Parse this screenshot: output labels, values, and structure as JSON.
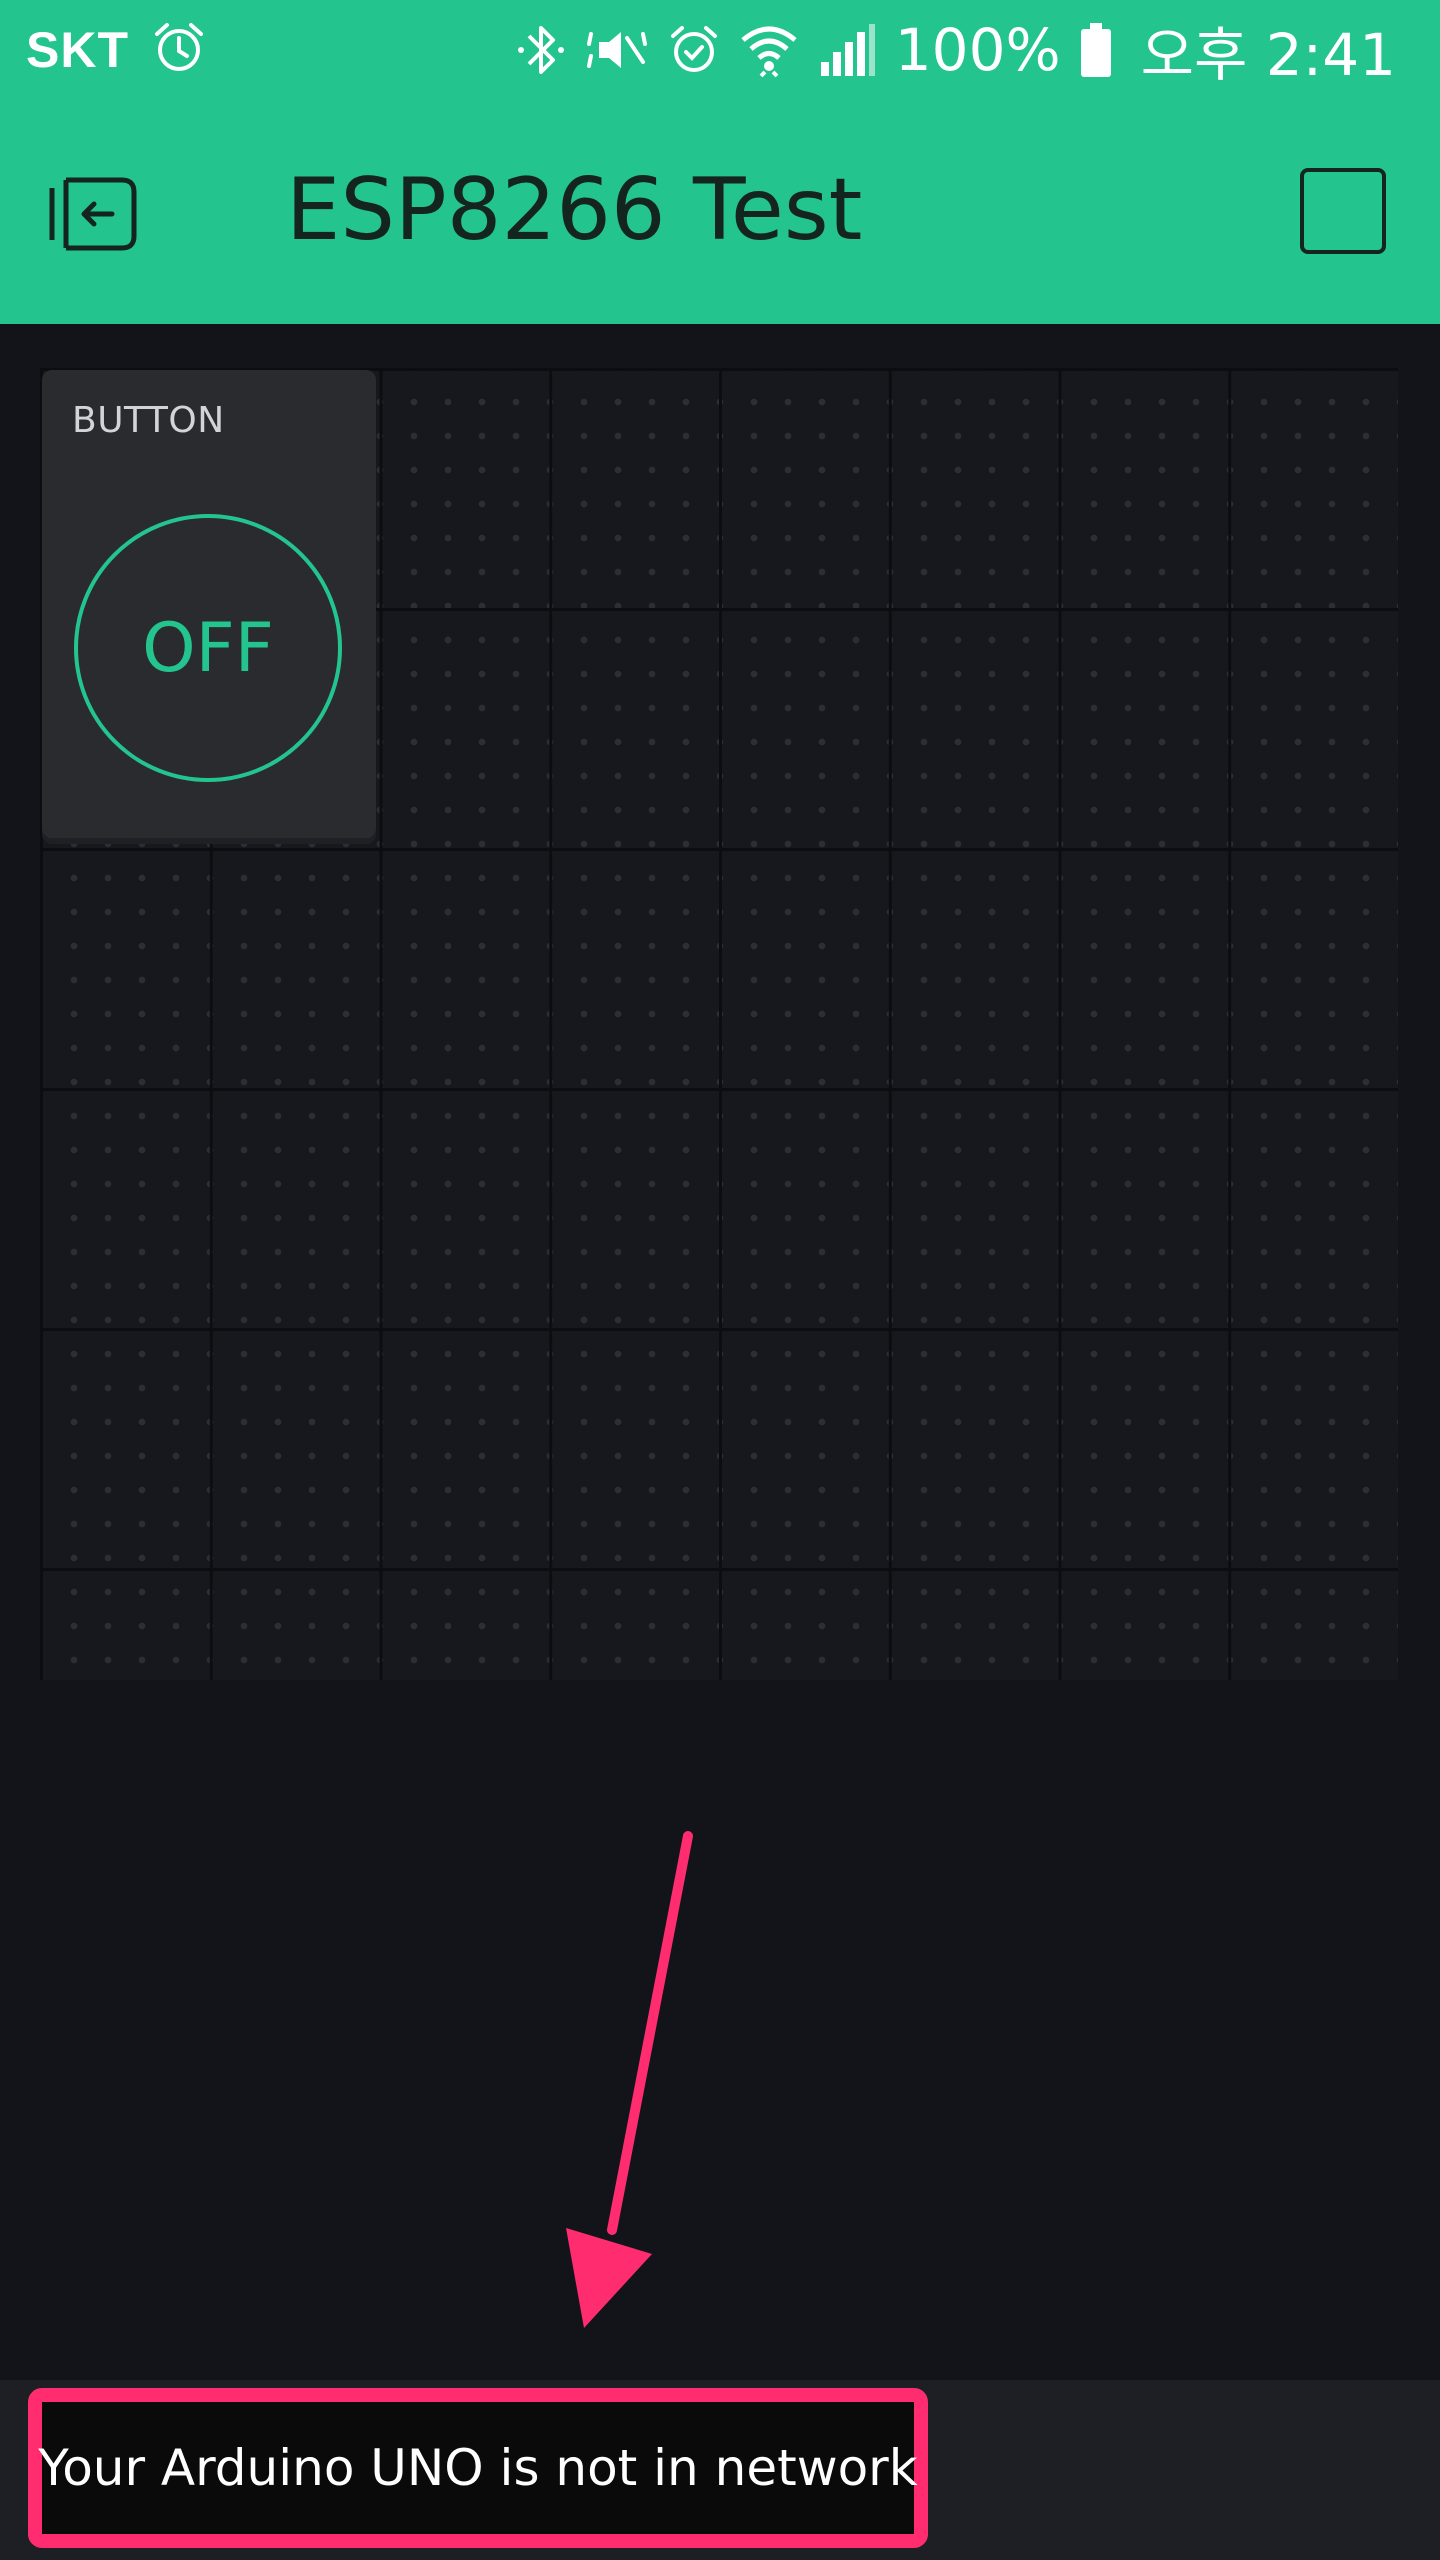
{
  "status_bar": {
    "carrier": "SKT",
    "battery": "100%",
    "time": "오후 2:41",
    "icons": [
      "alarm-icon",
      "bluetooth-icon",
      "vibrate-icon",
      "alarm-icon",
      "wifi-icon",
      "signal-icon",
      "battery-icon"
    ]
  },
  "app_bar": {
    "title": "ESP8266 Test",
    "back_icon": "exit-icon",
    "play_icon": "stop-square-icon"
  },
  "widget": {
    "label": "BUTTON",
    "state": "OFF"
  },
  "toast": {
    "message": "Your Arduino UNO is not in network"
  },
  "colors": {
    "accent": "#23C48E",
    "background": "#131419",
    "widget": "#2a2b2f",
    "highlight": "#FF2D6F"
  }
}
